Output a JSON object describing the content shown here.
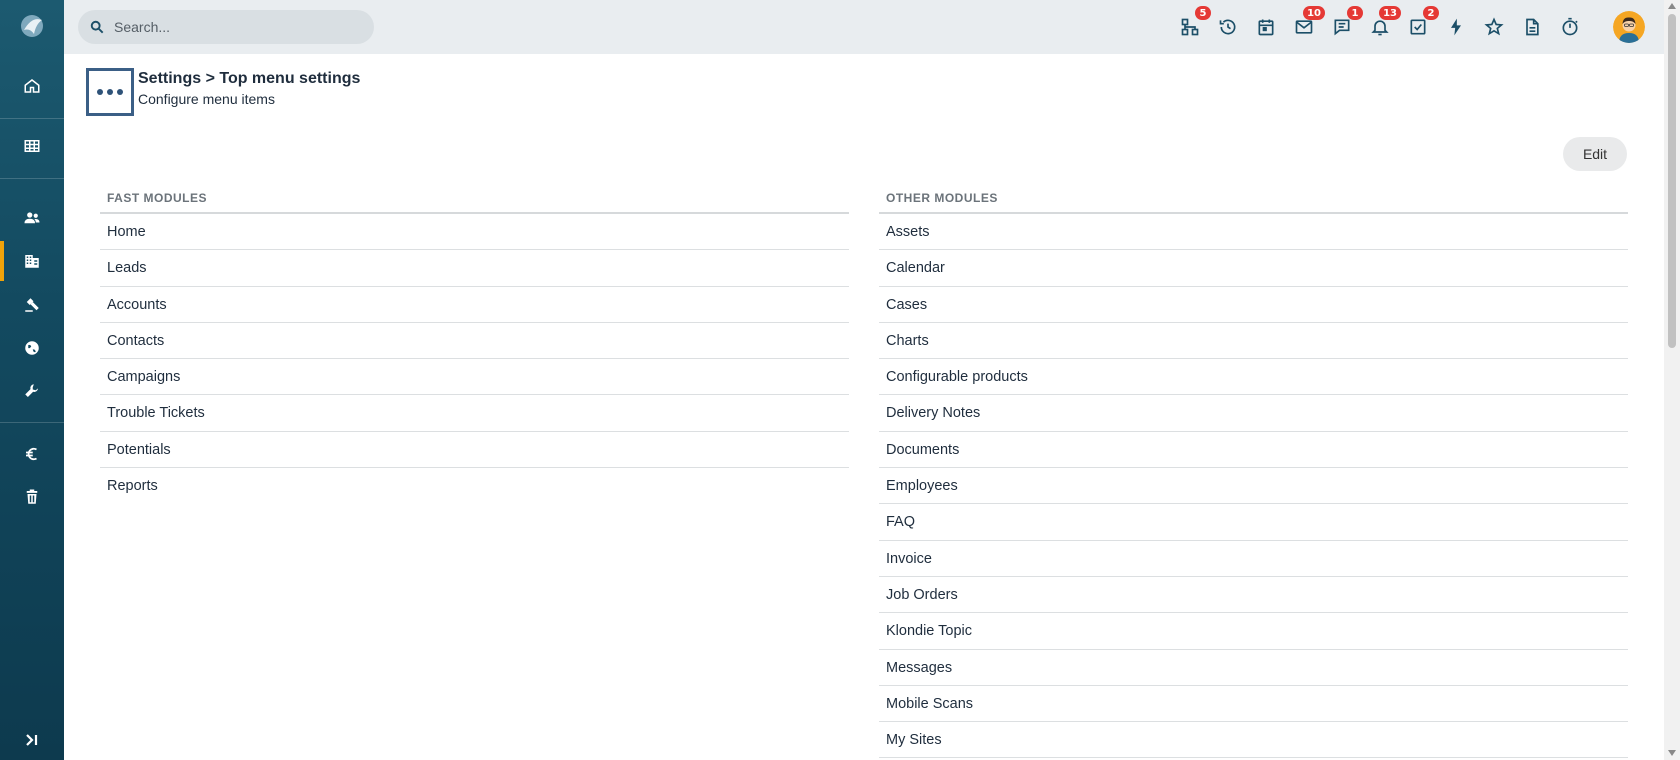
{
  "search": {
    "placeholder": "Search..."
  },
  "topbar_icons": [
    {
      "name": "hierarchy-icon",
      "badge": "5"
    },
    {
      "name": "history-icon",
      "badge": ""
    },
    {
      "name": "calendar-icon",
      "badge": ""
    },
    {
      "name": "mail-icon",
      "badge": "10"
    },
    {
      "name": "chat-icon",
      "badge": "1"
    },
    {
      "name": "bell-icon",
      "badge": "13"
    },
    {
      "name": "task-check-icon",
      "badge": "2"
    },
    {
      "name": "lightning-icon",
      "badge": ""
    },
    {
      "name": "star-icon",
      "badge": ""
    },
    {
      "name": "document-icon",
      "badge": ""
    },
    {
      "name": "stopwatch-icon",
      "badge": ""
    }
  ],
  "sidebar": {
    "items": [
      {
        "name": "home-icon"
      },
      {
        "name": "grid-icon"
      },
      {
        "name": "people-icon"
      },
      {
        "name": "building-icon",
        "active": true
      },
      {
        "name": "gavel-icon"
      },
      {
        "name": "globe-icon"
      },
      {
        "name": "wrench-icon"
      },
      {
        "name": "euro-icon"
      },
      {
        "name": "trash-icon"
      }
    ]
  },
  "header": {
    "title": "Settings > Top menu settings",
    "subtitle": "Configure menu items"
  },
  "edit_label": "Edit",
  "fast_modules": {
    "heading": "FAST MODULES",
    "items": [
      "Home",
      "Leads",
      "Accounts",
      "Contacts",
      "Campaigns",
      "Trouble Tickets",
      "Potentials",
      "Reports"
    ]
  },
  "other_modules": {
    "heading": "OTHER MODULES",
    "items": [
      "Assets",
      "Calendar",
      "Cases",
      "Charts",
      "Configurable products",
      "Delivery Notes",
      "Documents",
      "Employees",
      "FAQ",
      "Invoice",
      "Job Orders",
      "Klondie Topic",
      "Messages",
      "Mobile Scans",
      "My Sites"
    ]
  },
  "colors": {
    "sidebar": "#134a60",
    "accent": "#f0a30a",
    "badge": "#e53935",
    "icon": "#1c4f68"
  }
}
